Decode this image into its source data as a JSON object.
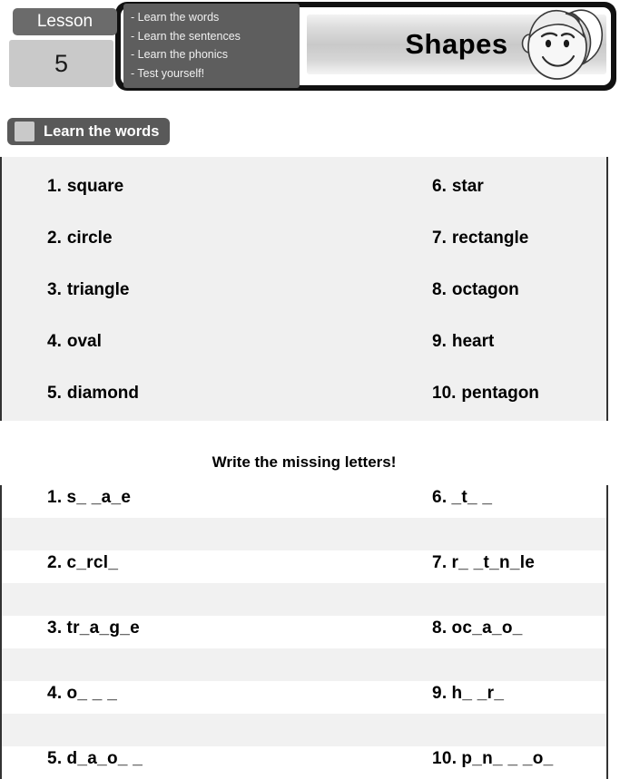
{
  "header": {
    "lesson_label": "Lesson",
    "lesson_number": "5",
    "title": "Shapes",
    "objectives": [
      "- Learn the words",
      "- Learn the sentences",
      "- Learn the phonics",
      "- Test yourself!"
    ],
    "mascot_icon": "girl-face-icon"
  },
  "section": {
    "heading": "Learn the words",
    "marker_icon": "square-marker-icon"
  },
  "vocabulary": {
    "left": [
      {
        "num": "1.",
        "word": "square"
      },
      {
        "num": "2.",
        "word": "circle"
      },
      {
        "num": "3.",
        "word": "triangle"
      },
      {
        "num": "4.",
        "word": "oval"
      },
      {
        "num": "5.",
        "word": "diamond"
      }
    ],
    "right": [
      {
        "num": "6.",
        "word": "star"
      },
      {
        "num": "7.",
        "word": "rectangle"
      },
      {
        "num": "8.",
        "word": "octagon"
      },
      {
        "num": "9.",
        "word": "heart"
      },
      {
        "num": "10.",
        "word": "pentagon"
      }
    ]
  },
  "exercise": {
    "title": "Write the missing letters!",
    "left": [
      {
        "num": "1.",
        "prompt": "s_ _a_e"
      },
      {
        "num": "2.",
        "prompt": "c_rcl_"
      },
      {
        "num": "3.",
        "prompt": "tr_a_g_e"
      },
      {
        "num": "4.",
        "prompt": "o_ _ _"
      },
      {
        "num": "5.",
        "prompt": "d_a_o_ _"
      }
    ],
    "right": [
      {
        "num": "6.",
        "prompt": "_t_ _"
      },
      {
        "num": "7.",
        "prompt": "r_ _t_n_le"
      },
      {
        "num": "8.",
        "prompt": "oc_a_o_"
      },
      {
        "num": "9.",
        "prompt": "h_ _r_"
      },
      {
        "num": "10.",
        "prompt": "p_n_ _ _o_"
      }
    ]
  },
  "colors": {
    "banner_frame": "#111111",
    "objectives_panel": "#5e5e5e",
    "lesson_label": "#6b6b6b",
    "lesson_number": "#c9c9c9",
    "section_pill": "#595959",
    "vocab_panel": "#f0f0f0",
    "row_band": "#f1f1f1"
  }
}
